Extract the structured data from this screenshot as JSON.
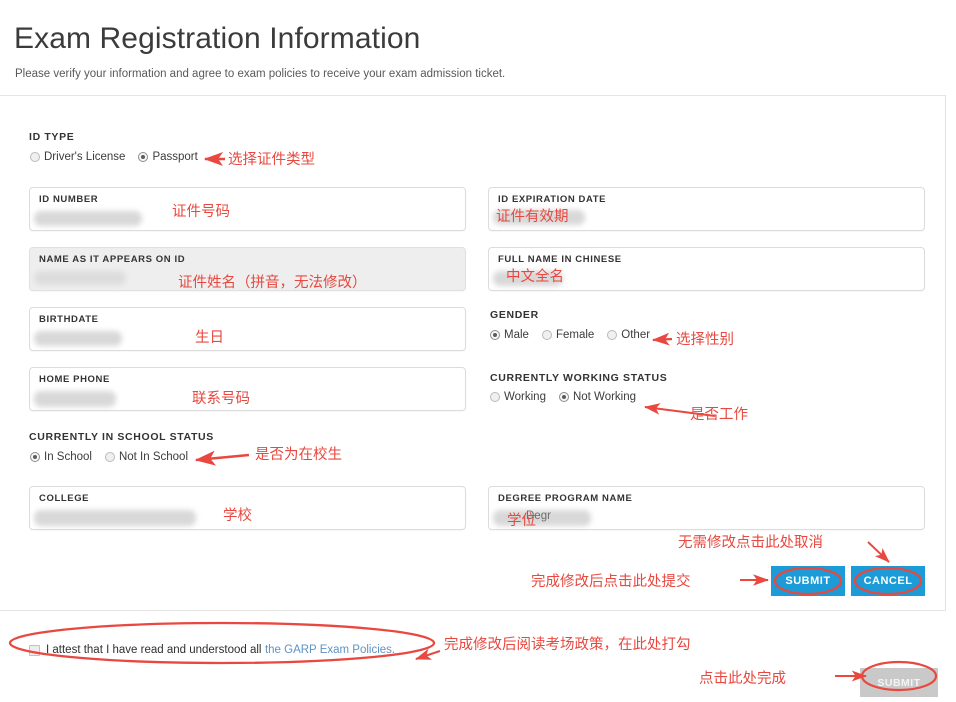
{
  "header": {
    "title": "Exam Registration Information",
    "subtitle": "Please verify your information and agree to exam policies to receive your exam admission ticket."
  },
  "colors": {
    "button_blue": "#1b9bd7",
    "button_grey": "#c9c9c9",
    "annotation_red": "#e8483f",
    "link_blue": "#5f93c4",
    "text_dark": "#333333"
  },
  "id_type": {
    "label": "ID TYPE",
    "options": [
      {
        "label": "Driver's License",
        "selected": false
      },
      {
        "label": "Passport",
        "selected": true
      }
    ]
  },
  "fields": {
    "id_number": {
      "label": "ID NUMBER",
      "value": "",
      "disabled": false
    },
    "id_expiration": {
      "label": "ID EXPIRATION DATE",
      "value": "",
      "disabled": false
    },
    "name_on_id": {
      "label": "NAME AS IT APPEARS ON ID",
      "value": "",
      "disabled": true
    },
    "chinese_name": {
      "label": "FULL NAME IN CHINESE",
      "value": "",
      "disabled": false
    },
    "birthdate": {
      "label": "BIRTHDATE",
      "value": "",
      "disabled": false
    },
    "home_phone": {
      "label": "HOME PHONE",
      "value": "",
      "disabled": false
    },
    "college": {
      "label": "COLLEGE",
      "value": "",
      "disabled": false
    },
    "degree_program": {
      "label": "DEGREE PROGRAM NAME",
      "value": "Degr",
      "disabled": false
    }
  },
  "gender": {
    "label": "GENDER",
    "options": [
      {
        "label": "Male",
        "selected": true
      },
      {
        "label": "Female",
        "selected": false
      },
      {
        "label": "Other",
        "selected": false
      }
    ]
  },
  "working_status": {
    "label": "CURRENTLY WORKING STATUS",
    "options": [
      {
        "label": "Working",
        "selected": false
      },
      {
        "label": "Not Working",
        "selected": true
      }
    ]
  },
  "school_status": {
    "label": "CURRENTLY IN SCHOOL STATUS",
    "options": [
      {
        "label": "In School",
        "selected": true
      },
      {
        "label": "Not In School",
        "selected": false
      }
    ]
  },
  "buttons": {
    "submit": "SUBMIT",
    "cancel": "CANCEL",
    "final_submit": "SUBMIT"
  },
  "attest": {
    "text": "I attest that I have read and understood all",
    "link": "the GARP Exam Policies.",
    "checked": false
  },
  "annotations": {
    "id_type": "选择证件类型",
    "id_number": "证件号码",
    "id_expiration": "证件有效期",
    "name_on_id": "证件姓名（拼音，无法修改）",
    "chinese_name": "中文全名",
    "birthdate": "生日",
    "gender": "选择性别",
    "home_phone": "联系号码",
    "working_status": "是否工作",
    "school_status": "是否为在校生",
    "college": "学校",
    "degree_program": "学位",
    "cancel_hint": "无需修改点击此处取消",
    "submit_hint": "完成修改后点击此处提交",
    "attest_hint": "完成修改后阅读考场政策，在此处打勾",
    "final_submit_hint": "点击此处完成"
  }
}
